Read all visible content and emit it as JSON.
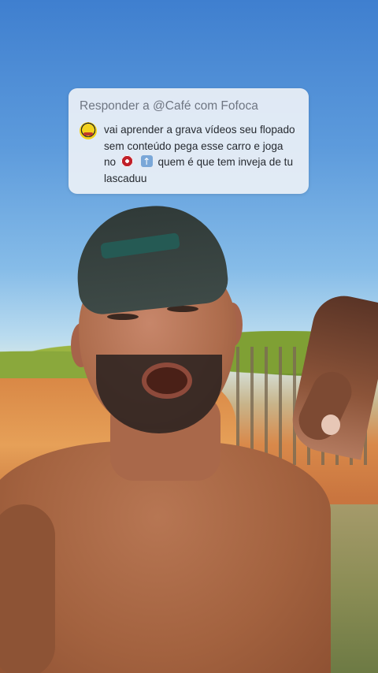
{
  "reply": {
    "header": "Responder a @Café com Fofoca",
    "comment_part1": "vai aprender a grava vídeos seu flopado sem conteúdo pega esse carro e joga no",
    "comment_part2": "quem é que tem inveja de tu lascaduu",
    "emoji_1": "no-entry-icon",
    "emoji_2": "up-arrow-icon"
  }
}
